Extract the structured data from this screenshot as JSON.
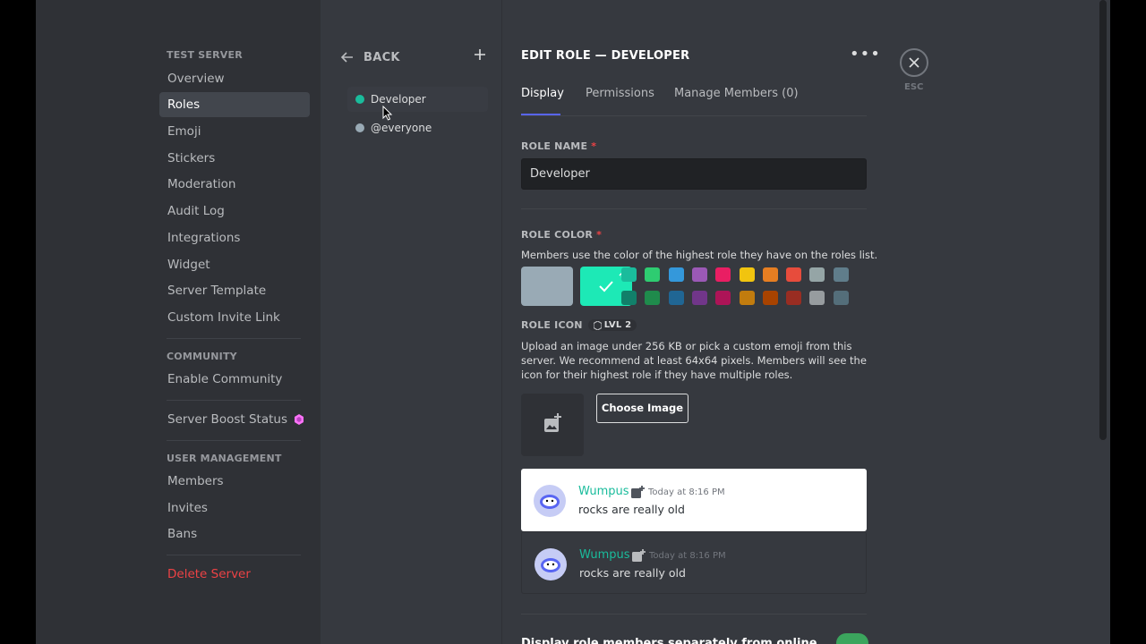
{
  "colors": {
    "accent": "#5865f2",
    "developer": "#1abc9c",
    "everyone": "#99aab5",
    "danger": "#ed4245",
    "boost": "#ff73fa",
    "green": "#3ba55d"
  },
  "sidebar": {
    "server_header": "TEST SERVER",
    "items": [
      {
        "label": "Overview",
        "active": false
      },
      {
        "label": "Roles",
        "active": true
      },
      {
        "label": "Emoji",
        "active": false
      },
      {
        "label": "Stickers",
        "active": false
      },
      {
        "label": "Moderation",
        "active": false
      },
      {
        "label": "Audit Log",
        "active": false
      },
      {
        "label": "Integrations",
        "active": false
      },
      {
        "label": "Widget",
        "active": false
      },
      {
        "label": "Server Template",
        "active": false
      },
      {
        "label": "Custom Invite Link",
        "active": false
      }
    ],
    "community_header": "COMMUNITY",
    "enable_community": "Enable Community",
    "server_boost": "Server Boost Status",
    "user_mgmt_header": "USER MANAGEMENT",
    "members": "Members",
    "invites": "Invites",
    "bans": "Bans",
    "delete_server": "Delete Server"
  },
  "roles_panel": {
    "back_label": "BACK",
    "roles": [
      {
        "name": "Developer",
        "color": "#1abc9c",
        "active": true
      },
      {
        "name": "@everyone",
        "color": "#99aab5",
        "active": false
      }
    ]
  },
  "edit": {
    "title": "EDIT ROLE — DEVELOPER",
    "tabs": [
      "Display",
      "Permissions",
      "Manage Members (0)"
    ],
    "role_name_label": "ROLE NAME",
    "role_name_value": "Developer",
    "role_color_label": "ROLE COLOR",
    "role_color_desc": "Members use the color of the highest role they have on the roles list.",
    "default_color": "#99aab5",
    "custom_color": "#1de9b6",
    "swatches_top": [
      "#1abc9c",
      "#2ecc71",
      "#3498db",
      "#9b59b6",
      "#e91e63",
      "#f1c40f",
      "#e67e22",
      "#e74c3c",
      "#95a5a6",
      "#607d8b"
    ],
    "swatches_bottom": [
      "#11806a",
      "#1f8b4c",
      "#206694",
      "#71368a",
      "#ad1457",
      "#c27c0e",
      "#a84300",
      "#992d22",
      "#979c9f",
      "#546e7a"
    ],
    "role_icon_label": "ROLE ICON",
    "role_icon_level": "LVL 2",
    "role_icon_desc": "Upload an image under 256 KB or pick a custom emoji from this server. We recommend at least 64x64 pixels. Members will see the icon for their highest role if they have multiple roles.",
    "choose_image": "Choose Image",
    "preview": {
      "username": "Wumpus",
      "timestamp": "Today at 8:16 PM",
      "message": "rocks are really old"
    },
    "display_separately": "Display role members separately from online members"
  },
  "close": {
    "esc_label": "ESC"
  }
}
